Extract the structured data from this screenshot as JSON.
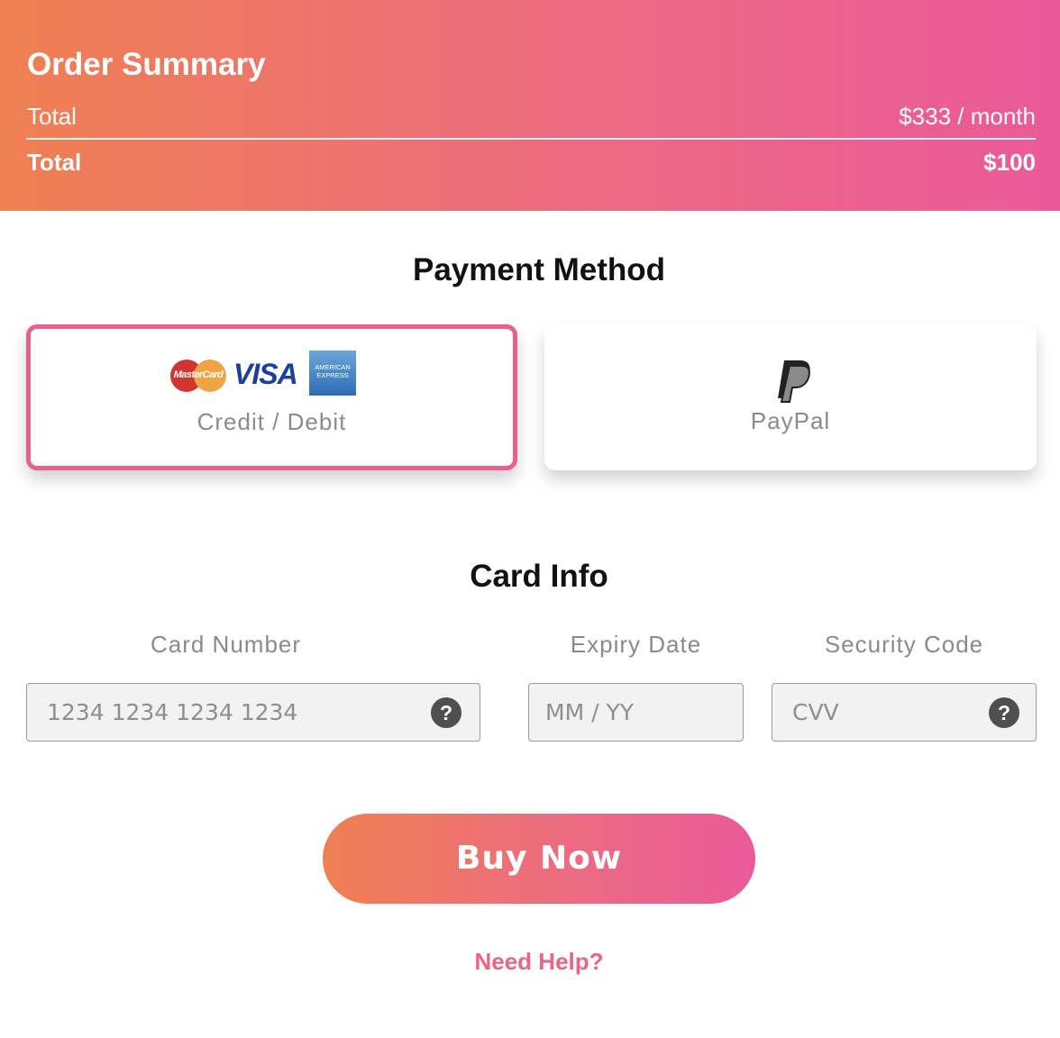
{
  "summary": {
    "title": "Order Summary",
    "row1_label": "Total",
    "row1_value": "$333 / month",
    "row2_label": "Total",
    "row2_value": "$100"
  },
  "payment_method": {
    "title": "Payment Method",
    "options": [
      {
        "label": "Credit / Debit",
        "selected": true,
        "logos": [
          "MasterCard",
          "VISA",
          "AMERICAN EXPRESS"
        ]
      },
      {
        "label": "PayPal",
        "selected": false
      }
    ]
  },
  "card_info": {
    "title": "Card Info",
    "card_number": {
      "label": "Card Number",
      "placeholder": "1234 1234 1234 1234",
      "value": ""
    },
    "expiry": {
      "label": "Expiry Date",
      "placeholder": "MM / YY",
      "value": ""
    },
    "cvv": {
      "label": "Security Code",
      "placeholder": "CVV",
      "value": ""
    },
    "help_glyph": "?"
  },
  "actions": {
    "buy_label": "Buy Now",
    "help_label": "Need Help?"
  },
  "colors": {
    "gradient_start": "#ef8052",
    "gradient_end": "#ea5a99",
    "selected_border": "#ea5f92"
  }
}
